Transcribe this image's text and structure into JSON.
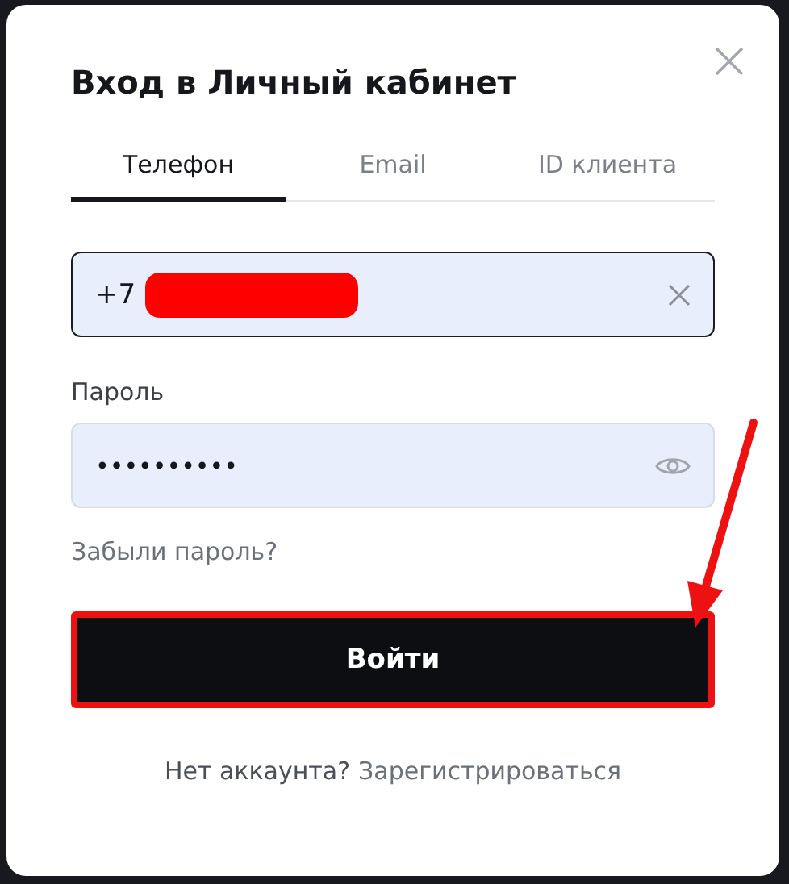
{
  "dialog": {
    "title": "Вход в Личный кабинет"
  },
  "tabs": [
    {
      "label": "Телефон",
      "selected": true
    },
    {
      "label": "Email",
      "selected": false
    },
    {
      "label": "ID клиента",
      "selected": false
    }
  ],
  "phone": {
    "value": "+7",
    "redacted": true
  },
  "password": {
    "label": "Пароль",
    "value": "••••••••••"
  },
  "forgot_link": "Забыли пароль?",
  "submit": {
    "label": "Войти",
    "highlighted": true
  },
  "pointer_arrow": true,
  "footer": {
    "text": "Нет аккаунта?",
    "link": "Зарегистрироваться"
  }
}
